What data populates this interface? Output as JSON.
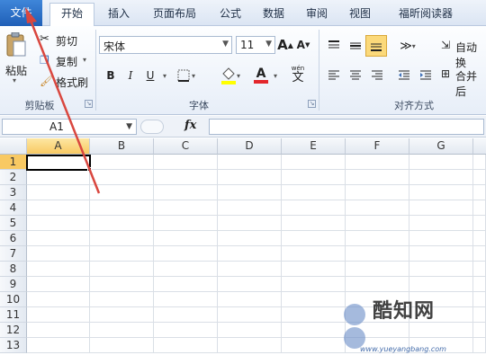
{
  "tabs": {
    "file": "文件",
    "items": [
      "开始",
      "插入",
      "页面布局",
      "公式",
      "数据",
      "审阅",
      "视图",
      "福昕阅读器"
    ]
  },
  "clipboard": {
    "paste": "粘贴",
    "cut": "剪切",
    "copy": "复制",
    "format_painter": "格式刷",
    "group_label": "剪贴板"
  },
  "font": {
    "name": "宋体",
    "size": "11",
    "bold": "B",
    "italic": "I",
    "underline": "U",
    "grow": "A",
    "shrink": "A",
    "font_color_letter": "A",
    "phonetic": "wén",
    "group_label": "字体"
  },
  "alignment": {
    "wrap_text": "自动换",
    "merge_center": "合并后",
    "group_label": "对齐方式"
  },
  "formula_bar": {
    "name_box": "A1",
    "fx": "fx",
    "value": ""
  },
  "grid": {
    "columns": [
      "A",
      "B",
      "C",
      "D",
      "E",
      "F",
      "G"
    ],
    "rows": [
      "1",
      "2",
      "3",
      "4",
      "5",
      "6",
      "7",
      "8",
      "9",
      "10",
      "11",
      "12",
      "13"
    ],
    "selected_cell": "A1"
  },
  "watermark": {
    "brand": "酷知网",
    "site": "www.yueyangbang.com"
  },
  "colors": {
    "file_tab": "#2a6fc9",
    "selection_header": "#f8c963",
    "arrow": "#d9473f"
  }
}
